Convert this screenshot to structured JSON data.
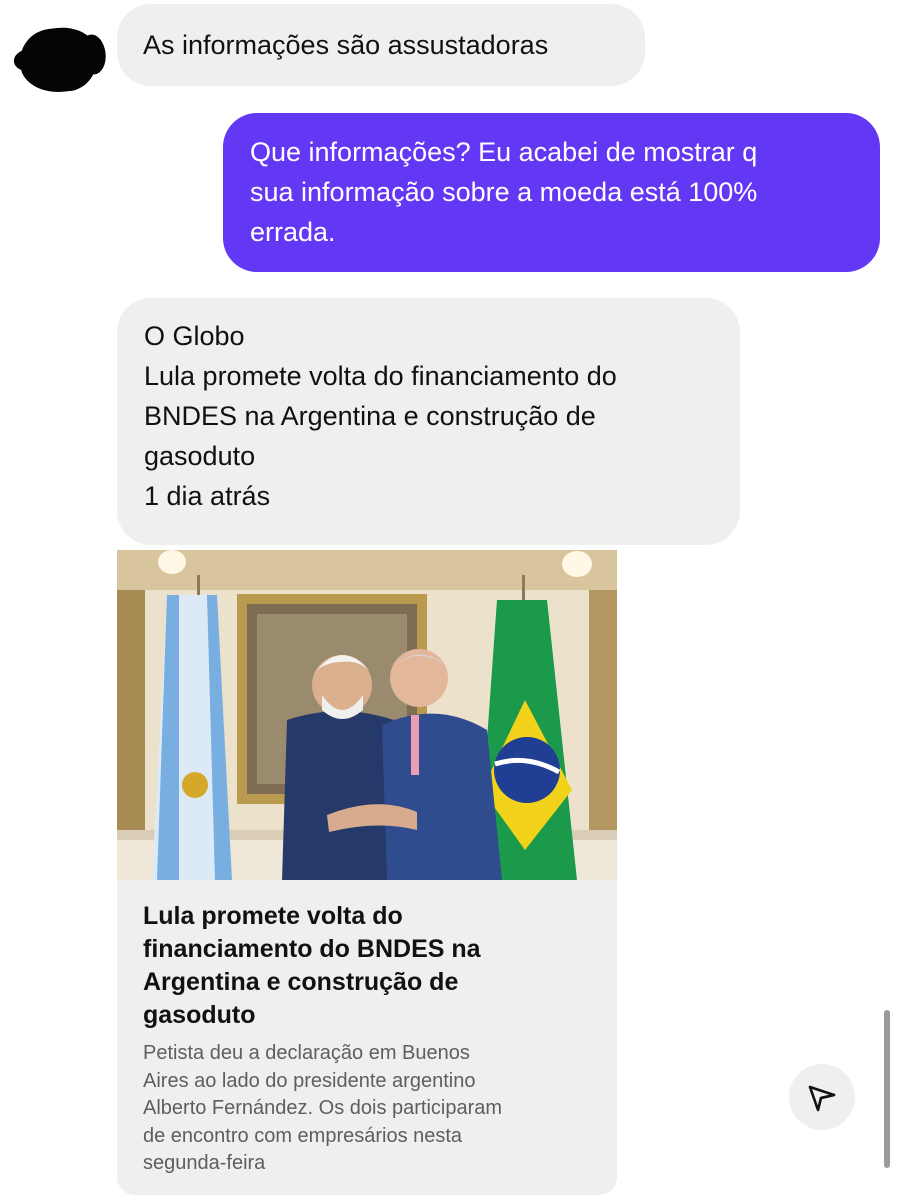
{
  "thread": {
    "messages": [
      {
        "from": "them",
        "text": "As informações são assustadoras"
      },
      {
        "from": "me",
        "lines": [
          "Que informações? Eu acabei de mostrar q",
          "sua informação sobre a moeda está 100%",
          "errada."
        ]
      },
      {
        "from": "them",
        "lines": [
          "O Globo",
          "Lula promete volta do financiamento do",
          "BNDES na Argentina e construção de",
          "gasoduto",
          "1 dia atrás"
        ]
      }
    ],
    "link_preview": {
      "image_alt": "Lula e Alberto Fernández se abraçam entre as bandeiras da Argentina e do Brasil",
      "title_lines": [
        "Lula promete volta do",
        "financiamento do BNDES na",
        "Argentina e construção de",
        "gasoduto"
      ],
      "description_lines": [
        "Petista deu a declaração em Buenos",
        "Aires ao lado do presidente argentino",
        "Alberto Fernández. Os dois participaram",
        "de encontro com empresários nesta",
        "segunda-feira"
      ]
    }
  },
  "actions": {
    "share_icon": "paper-plane-icon"
  },
  "colors": {
    "outgoing_bubble": "#6238f5",
    "incoming_bubble": "#efefef",
    "link_description": "#5e5e5e"
  }
}
